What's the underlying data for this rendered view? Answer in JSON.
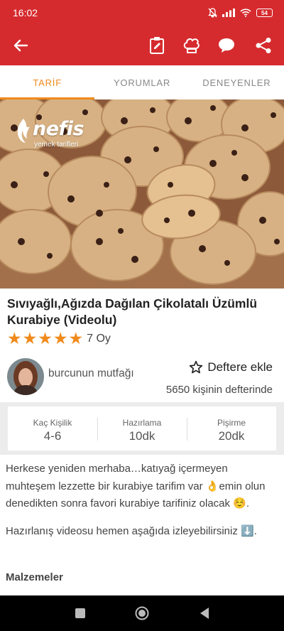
{
  "status": {
    "time": "16:02",
    "battery": "54"
  },
  "tabs": [
    {
      "label": "TARİF",
      "active": true
    },
    {
      "label": "YORUMLAR",
      "active": false
    },
    {
      "label": "DENEYENLER",
      "active": false
    }
  ],
  "hero": {
    "brand": "nefis",
    "brand_sub": "yemek tarifleri"
  },
  "recipe": {
    "title": "Sıvıyağlı,Ağızda Dağılan Çikolatalı Üzümlü Kurabiye (Videolu)",
    "rating_stars": 5,
    "rating_text": "7 Oy"
  },
  "author": {
    "name": "burcunun mutfağı",
    "add_label": "Deftere ekle",
    "book_count": "5650 kişinin defterinde"
  },
  "info": [
    {
      "label": "Kaç Kişilik",
      "value": "4-6"
    },
    {
      "label": "Hazırlama",
      "value": "10dk"
    },
    {
      "label": "Pişirme",
      "value": "20dk"
    }
  ],
  "description": {
    "intro": "Herkese yeniden merhaba…katıyağ içermeyen muhteşem lezzette bir kurabiye tarifim var 👌emin olun denedikten sonra favori kurabiye tarifiniz olacak ☺️.",
    "video": "Hazırlanış videosu hemen aşağıda izleyebilirsiniz ⬇️."
  },
  "section_title": "Malzemeler",
  "colors": {
    "primary": "#d62b2e",
    "accent": "#f08a1c"
  },
  "icons": [
    "back-icon",
    "notes-icon",
    "chef-hat-icon",
    "comment-icon",
    "share-icon",
    "star-outline-icon"
  ]
}
